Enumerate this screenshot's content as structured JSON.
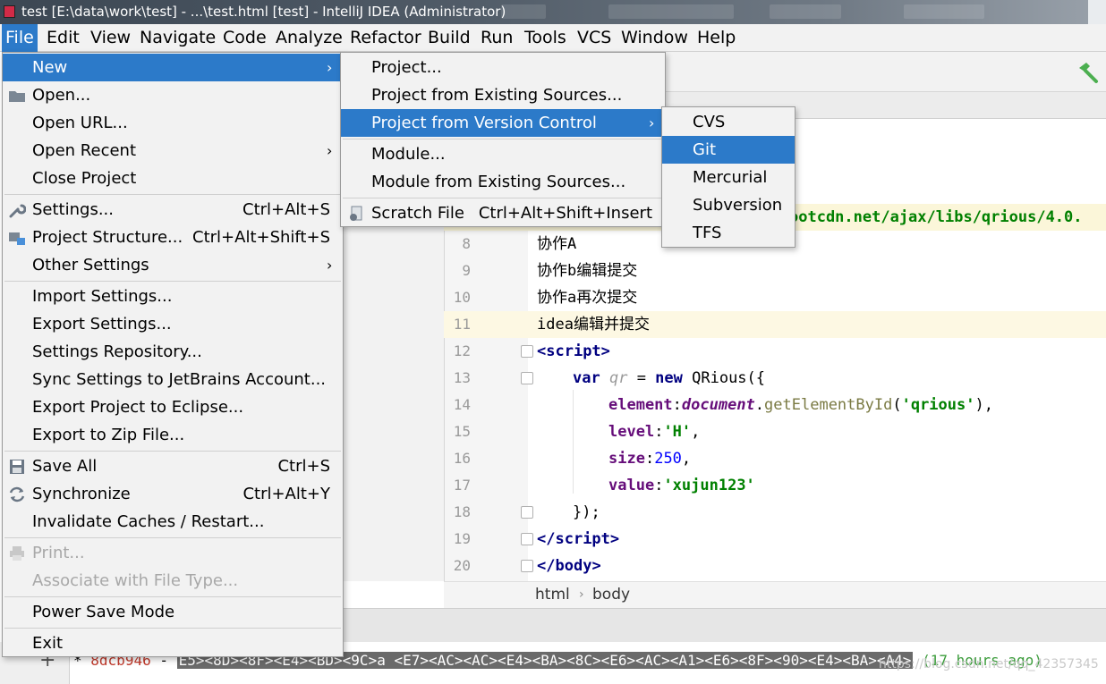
{
  "window": {
    "title": "test [E:\\data\\work\\test] - ...\\test.html [test] - IntelliJ IDEA (Administrator)"
  },
  "menubar": [
    {
      "label": "File",
      "active": true
    },
    {
      "label": "Edit"
    },
    {
      "label": "View"
    },
    {
      "label": "Navigate"
    },
    {
      "label": "Code"
    },
    {
      "label": "Analyze"
    },
    {
      "label": "Refactor"
    },
    {
      "label": "Build"
    },
    {
      "label": "Run"
    },
    {
      "label": "Tools"
    },
    {
      "label": "VCS"
    },
    {
      "label": "Window"
    },
    {
      "label": "Help"
    }
  ],
  "file_menu": {
    "items": [
      {
        "label": "New",
        "submenu": true,
        "highlight": true
      },
      {
        "label": "Open...",
        "icon": "folder-icon"
      },
      {
        "label": "Open URL..."
      },
      {
        "label": "Open Recent",
        "submenu": true
      },
      {
        "label": "Close Project"
      },
      {
        "label": "Settings...",
        "shortcut": "Ctrl+Alt+S",
        "icon": "wrench-icon"
      },
      {
        "label": "Project Structure...",
        "shortcut": "Ctrl+Alt+Shift+S",
        "icon": "project-structure-icon"
      },
      {
        "label": "Other Settings",
        "submenu": true
      },
      {
        "label": "Import Settings..."
      },
      {
        "label": "Export Settings..."
      },
      {
        "label": "Settings Repository..."
      },
      {
        "label": "Sync Settings to JetBrains Account..."
      },
      {
        "label": "Export Project to Eclipse..."
      },
      {
        "label": "Export to Zip File..."
      },
      {
        "label": "Save All",
        "shortcut": "Ctrl+S",
        "icon": "save-icon"
      },
      {
        "label": "Synchronize",
        "shortcut": "Ctrl+Alt+Y",
        "icon": "sync-icon"
      },
      {
        "label": "Invalidate Caches / Restart..."
      },
      {
        "label": "Print...",
        "disabled": true,
        "icon": "printer-icon"
      },
      {
        "label": "Associate with File Type...",
        "disabled": true
      },
      {
        "label": "Power Save Mode"
      },
      {
        "label": "Exit"
      }
    ]
  },
  "new_menu": {
    "items": [
      {
        "label": "Project..."
      },
      {
        "label": "Project from Existing Sources..."
      },
      {
        "label": "Project from Version Control",
        "submenu": true,
        "highlight": true
      },
      {
        "label": "Module..."
      },
      {
        "label": "Module from Existing Sources..."
      },
      {
        "label": "Scratch File",
        "shortcut": "Ctrl+Alt+Shift+Insert",
        "icon": "scratch-file-icon"
      }
    ]
  },
  "vcs_menu": {
    "items": [
      {
        "label": "CVS"
      },
      {
        "label": "Git",
        "highlight": true
      },
      {
        "label": "Mercurial"
      },
      {
        "label": "Subversion"
      },
      {
        "label": "TFS"
      }
    ]
  },
  "editor": {
    "url_fragment": "ootcdn.net/ajax/libs/qrious/4.0.",
    "lines": [
      {
        "num": "8",
        "text": "协作A"
      },
      {
        "num": "9",
        "text": "协作b编辑提交"
      },
      {
        "num": "10",
        "text": "协作a再次提交"
      },
      {
        "num": "11",
        "text": "idea编辑并提交"
      },
      {
        "num": "12",
        "tag_open": "<",
        "tag_name": "script",
        "tag_close": ">"
      },
      {
        "num": "13",
        "kw1": "var",
        "ident": "qr",
        "op": " = ",
        "kw2": "new",
        "rest": " QRious({"
      },
      {
        "num": "14",
        "prop": "element",
        "colon": ":",
        "obj": "document",
        "dot": ".",
        "fn": "getElementById",
        "open": "(",
        "str": "'qrious'",
        "close": "),"
      },
      {
        "num": "15",
        "prop": "level",
        "colon": ":",
        "str": "'H'",
        "close": ","
      },
      {
        "num": "16",
        "prop": "size",
        "colon": ":",
        "num_val": "250",
        "close": ","
      },
      {
        "num": "17",
        "prop": "value",
        "colon": ":",
        "str": "'xujun123'"
      },
      {
        "num": "18",
        "text": "});"
      },
      {
        "num": "19",
        "tag_open": "</",
        "tag_name": "script",
        "tag_close": ">"
      },
      {
        "num": "20",
        "tag_open": "</",
        "tag_name": "body",
        "tag_close": ">"
      }
    ]
  },
  "breadcrumb": [
    "html",
    "body"
  ],
  "vcs_log": {
    "hash": "8dcb946",
    "prefix": "*",
    "dash": "-",
    "message_bytes": "E5><8D><8F><E4><BD><9C>a <E7><AC><AC><E4><BA><8C><E6><AC><A1><E6><8F><90><E4><BA><A4>",
    "ago": "(17 hours ago)",
    "watermark": "https://blog.csdn.net/qq_42357345"
  },
  "colors": {
    "accent": "#2c7ac9",
    "menu_bg": "#f2f2f2",
    "tag": "#000080",
    "string": "#008000",
    "number": "#0000ff",
    "property": "#660e7a"
  }
}
